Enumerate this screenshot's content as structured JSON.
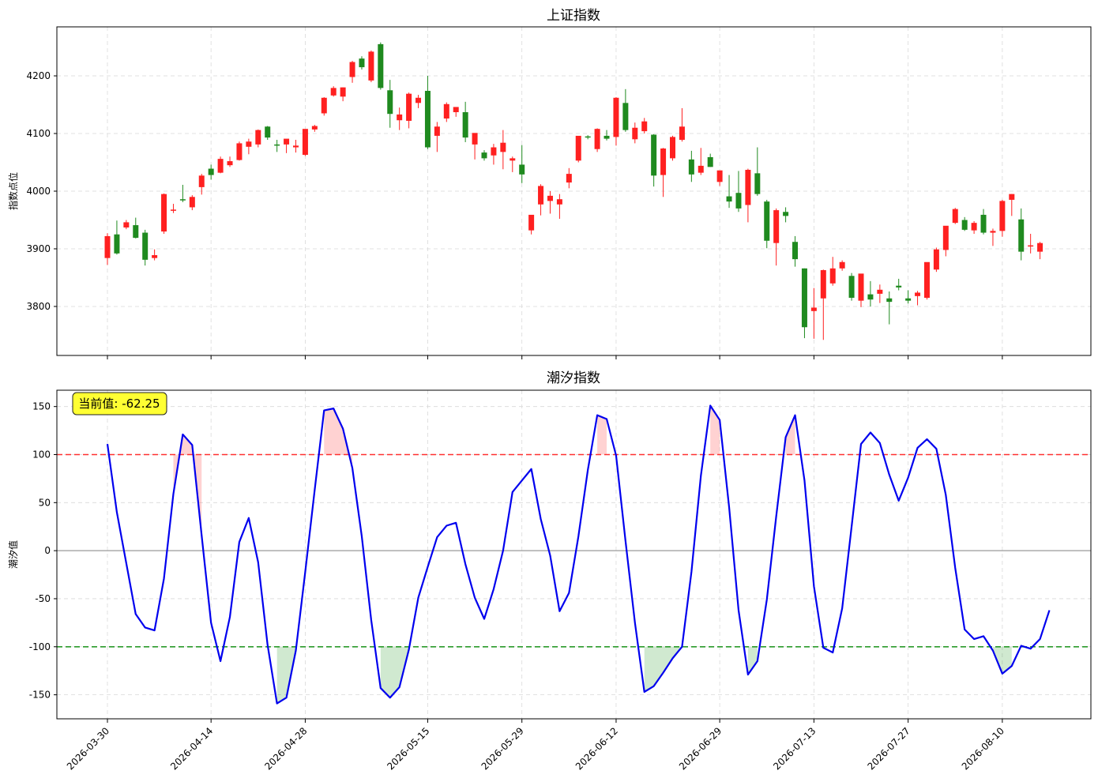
{
  "chart_data": [
    {
      "type": "candlestick",
      "title": "上证指数",
      "ylabel": "指数点位",
      "xlabel": "",
      "ylim": [
        3715,
        4285
      ],
      "yticks": [
        3800,
        3900,
        4000,
        4100,
        4200
      ],
      "grid": true,
      "colors": {
        "up": "#ff2020",
        "down": "#1f8a1f"
      },
      "x": [
        "2026-03-30",
        "2026-03-31",
        "2026-04-01",
        "2026-04-02",
        "2026-04-03",
        "2026-04-06",
        "2026-04-07",
        "2026-04-08",
        "2026-04-09",
        "2026-04-10",
        "2026-04-13",
        "2026-04-14",
        "2026-04-15",
        "2026-04-16",
        "2026-04-17",
        "2026-04-20",
        "2026-04-21",
        "2026-04-22",
        "2026-04-23",
        "2026-04-24",
        "2026-04-27",
        "2026-04-28",
        "2026-04-29",
        "2026-04-30",
        "2026-05-01",
        "2026-05-04",
        "2026-05-05",
        "2026-05-06",
        "2026-05-07",
        "2026-05-08",
        "2026-05-11",
        "2026-05-12",
        "2026-05-13",
        "2026-05-14",
        "2026-05-15",
        "2026-05-18",
        "2026-05-19",
        "2026-05-20",
        "2026-05-21",
        "2026-05-22",
        "2026-05-25",
        "2026-05-26",
        "2026-05-27",
        "2026-05-28",
        "2026-05-29",
        "2026-06-01",
        "2026-06-02",
        "2026-06-03",
        "2026-06-04",
        "2026-06-05",
        "2026-06-08",
        "2026-06-09",
        "2026-06-10",
        "2026-06-11",
        "2026-06-12",
        "2026-06-15",
        "2026-06-16",
        "2026-06-17",
        "2026-06-18",
        "2026-06-19",
        "2026-06-22",
        "2026-06-23",
        "2026-06-24",
        "2026-06-25",
        "2026-06-26",
        "2026-06-29",
        "2026-06-30",
        "2026-07-01",
        "2026-07-02",
        "2026-07-03",
        "2026-07-06",
        "2026-07-07",
        "2026-07-08",
        "2026-07-09",
        "2026-07-10",
        "2026-07-13",
        "2026-07-14",
        "2026-07-15",
        "2026-07-16",
        "2026-07-17",
        "2026-07-20",
        "2026-07-21",
        "2026-07-22",
        "2026-07-23",
        "2026-07-24",
        "2026-07-27",
        "2026-07-28",
        "2026-07-29",
        "2026-07-30",
        "2026-07-31",
        "2026-08-03",
        "2026-08-04",
        "2026-08-05",
        "2026-08-06",
        "2026-08-07",
        "2026-08-10",
        "2026-08-11",
        "2026-08-12",
        "2026-08-13",
        "2026-08-14",
        "2026-08-17",
        "2026-08-18",
        "2026-08-19",
        "2026-08-20",
        "2026-08-21",
        "2026-08-24"
      ],
      "xticks": [
        "2026-03-30",
        "2026-04-14",
        "2026-04-28",
        "2026-05-15",
        "2026-05-29",
        "2026-06-12",
        "2026-06-29",
        "2026-07-13",
        "2026-07-27",
        "2026-08-10"
      ],
      "ohlc": [
        [
          3884,
          3927,
          3872,
          3922
        ],
        [
          3925,
          3949,
          3890,
          3892
        ],
        [
          3937,
          3950,
          3934,
          3946
        ],
        [
          3941,
          3954,
          3918,
          3919
        ],
        [
          3928,
          3933,
          3871,
          3881
        ],
        [
          3884,
          3899,
          3880,
          3889
        ],
        [
          3930,
          3996,
          3926,
          3995
        ],
        [
          3966,
          3978,
          3962,
          3968
        ],
        [
          3986,
          4011,
          3981,
          3985
        ],
        [
          3972,
          3993,
          3967,
          3990
        ],
        [
          4007,
          4030,
          3994,
          4027
        ],
        [
          4039,
          4046,
          4020,
          4028
        ],
        [
          4032,
          4060,
          4031,
          4056
        ],
        [
          4045,
          4060,
          4042,
          4052
        ],
        [
          4054,
          4086,
          4053,
          4083
        ],
        [
          4077,
          4091,
          4064,
          4086
        ],
        [
          4081,
          4107,
          4076,
          4106
        ],
        [
          4112,
          4113,
          4089,
          4093
        ],
        [
          4081,
          4089,
          4068,
          4080
        ],
        [
          4081,
          4087,
          4066,
          4091
        ],
        [
          4076,
          4089,
          4067,
          4079
        ],
        [
          4063,
          4105,
          4061,
          4108
        ],
        [
          4107,
          4115,
          4103,
          4113
        ],
        [
          4135,
          4163,
          4131,
          4162
        ],
        [
          4166,
          4182,
          4164,
          4179
        ],
        [
          4164,
          4180,
          4156,
          4180
        ],
        [
          4198,
          4226,
          4188,
          4224
        ],
        [
          4230,
          4234,
          4211,
          4215
        ],
        [
          4192,
          4244,
          4189,
          4242
        ],
        [
          4255,
          4258,
          4176,
          4179
        ],
        [
          4175,
          4193,
          4110,
          4134
        ],
        [
          4123,
          4145,
          4106,
          4133
        ],
        [
          4122,
          4171,
          4109,
          4169
        ],
        [
          4153,
          4167,
          4144,
          4162
        ],
        [
          4174,
          4200,
          4073,
          4076
        ],
        [
          4096,
          4120,
          4068,
          4112
        ],
        [
          4126,
          4154,
          4120,
          4151
        ],
        [
          4137,
          4145,
          4129,
          4146
        ],
        [
          4137,
          4155,
          4085,
          4093
        ],
        [
          4081,
          4098,
          4055,
          4101
        ],
        [
          4067,
          4071,
          4053,
          4057
        ],
        [
          4062,
          4082,
          4046,
          4076
        ],
        [
          4068,
          4106,
          4038,
          4084
        ],
        [
          4053,
          4060,
          4033,
          4057
        ],
        [
          4046,
          4080,
          4014,
          4029
        ],
        [
          3932,
          3958,
          3925,
          3959
        ],
        [
          3977,
          4012,
          3958,
          4009
        ],
        [
          3983,
          4000,
          3961,
          3992
        ],
        [
          3977,
          3995,
          3952,
          3986
        ],
        [
          4015,
          4040,
          4005,
          4030
        ],
        [
          4053,
          4095,
          4050,
          4096
        ],
        [
          4095,
          4097,
          4090,
          4093
        ],
        [
          4073,
          4109,
          4068,
          4108
        ],
        [
          4096,
          4106,
          4088,
          4091
        ],
        [
          4094,
          4163,
          4079,
          4162
        ],
        [
          4153,
          4177,
          4103,
          4106
        ],
        [
          4090,
          4119,
          4083,
          4110
        ],
        [
          4104,
          4127,
          4100,
          4121
        ],
        [
          4098,
          4099,
          4008,
          4027
        ],
        [
          4028,
          4075,
          3990,
          4074
        ],
        [
          4057,
          4096,
          4053,
          4094
        ],
        [
          4089,
          4144,
          4086,
          4112
        ],
        [
          4055,
          4070,
          4016,
          4029
        ],
        [
          4032,
          4075,
          4028,
          4044
        ],
        [
          4059,
          4065,
          4042,
          4042
        ],
        [
          4016,
          4030,
          4009,
          4036
        ],
        [
          3991,
          4028,
          3971,
          3982
        ],
        [
          3997,
          4035,
          3964,
          3970
        ],
        [
          3976,
          4039,
          3946,
          4037
        ],
        [
          4031,
          4076,
          3992,
          3995
        ],
        [
          3982,
          3985,
          3901,
          3914
        ],
        [
          3910,
          3970,
          3871,
          3967
        ],
        [
          3964,
          3972,
          3946,
          3957
        ],
        [
          3912,
          3922,
          3869,
          3882
        ],
        [
          3866,
          3866,
          3745,
          3764
        ],
        [
          3792,
          3832,
          3744,
          3798
        ],
        [
          3814,
          3864,
          3742,
          3863
        ],
        [
          3840,
          3886,
          3836,
          3866
        ],
        [
          3866,
          3880,
          3862,
          3877
        ],
        [
          3853,
          3858,
          3810,
          3815
        ],
        [
          3810,
          3836,
          3799,
          3857
        ],
        [
          3821,
          3844,
          3800,
          3812
        ],
        [
          3822,
          3838,
          3806,
          3829
        ],
        [
          3814,
          3826,
          3769,
          3808
        ],
        [
          3836,
          3848,
          3828,
          3833
        ],
        [
          3814,
          3828,
          3805,
          3810
        ],
        [
          3818,
          3827,
          3802,
          3824
        ],
        [
          3815,
          3862,
          3812,
          3877
        ],
        [
          3864,
          3902,
          3860,
          3899
        ],
        [
          3898,
          3937,
          3887,
          3940
        ],
        [
          3945,
          3971,
          3943,
          3969
        ],
        [
          3950,
          3955,
          3931,
          3933
        ],
        [
          3932,
          3948,
          3926,
          3945
        ],
        [
          3959,
          3969,
          3925,
          3928
        ],
        [
          3928,
          3935,
          3905,
          3931
        ],
        [
          3931,
          3985,
          3921,
          3983
        ],
        [
          3985,
          3995,
          3957,
          3995
        ],
        [
          3951,
          3970,
          3880,
          3895
        ],
        [
          3906,
          3926,
          3892,
          3906
        ],
        [
          3895,
          3912,
          3882,
          3910
        ]
      ]
    },
    {
      "type": "line",
      "title": "潮汐指数",
      "ylabel": "潮汐值",
      "xlabel": "",
      "ylim": [
        -175,
        167
      ],
      "yticks": [
        -150,
        -100,
        -50,
        0,
        50,
        100,
        150
      ],
      "upper_threshold": 100,
      "lower_threshold": -100,
      "grid": true,
      "colors": {
        "line": "#0000ee",
        "upper": "#ff3030",
        "lower": "#2a9a2a"
      },
      "current_value_label": "当前值: -62.25",
      "x": [
        "2026-03-30",
        "2026-03-31",
        "2026-04-01",
        "2026-04-02",
        "2026-04-03",
        "2026-04-06",
        "2026-04-07",
        "2026-04-08",
        "2026-04-09",
        "2026-04-10",
        "2026-04-13",
        "2026-04-14",
        "2026-04-15",
        "2026-04-16",
        "2026-04-17",
        "2026-04-20",
        "2026-04-21",
        "2026-04-22",
        "2026-04-23",
        "2026-04-24",
        "2026-04-27",
        "2026-04-28",
        "2026-04-29",
        "2026-04-30",
        "2026-05-01",
        "2026-05-04",
        "2026-05-05",
        "2026-05-06",
        "2026-05-07",
        "2026-05-08",
        "2026-05-11",
        "2026-05-12",
        "2026-05-13",
        "2026-05-14",
        "2026-05-15",
        "2026-05-18",
        "2026-05-19",
        "2026-05-20",
        "2026-05-21",
        "2026-05-22",
        "2026-05-25",
        "2026-05-26",
        "2026-05-27",
        "2026-05-28",
        "2026-05-29",
        "2026-06-01",
        "2026-06-02",
        "2026-06-03",
        "2026-06-04",
        "2026-06-05",
        "2026-06-08",
        "2026-06-09",
        "2026-06-10",
        "2026-06-11",
        "2026-06-12",
        "2026-06-15",
        "2026-06-16",
        "2026-06-17",
        "2026-06-18",
        "2026-06-19",
        "2026-06-22",
        "2026-06-23",
        "2026-06-24",
        "2026-06-25",
        "2026-06-26",
        "2026-06-29",
        "2026-06-30",
        "2026-07-01",
        "2026-07-02",
        "2026-07-03",
        "2026-07-06",
        "2026-07-07",
        "2026-07-08",
        "2026-07-09",
        "2026-07-10",
        "2026-07-13",
        "2026-07-14",
        "2026-07-15",
        "2026-07-16",
        "2026-07-17",
        "2026-07-20",
        "2026-07-21",
        "2026-07-22",
        "2026-07-23",
        "2026-07-24",
        "2026-07-27",
        "2026-07-28",
        "2026-07-29",
        "2026-07-30",
        "2026-07-31",
        "2026-08-03",
        "2026-08-04",
        "2026-08-05",
        "2026-08-06",
        "2026-08-07",
        "2026-08-10",
        "2026-08-11",
        "2026-08-12",
        "2026-08-13",
        "2026-08-14",
        "2026-08-17",
        "2026-08-18",
        "2026-08-19",
        "2026-08-20",
        "2026-08-21",
        "2026-08-24"
      ],
      "xticks": [
        "2026-03-30",
        "2026-04-14",
        "2026-04-28",
        "2026-05-15",
        "2026-05-29",
        "2026-06-12",
        "2026-06-29",
        "2026-07-13",
        "2026-07-27",
        "2026-08-10"
      ],
      "values": [
        111,
        40,
        -13,
        -66,
        -80,
        -83,
        -29,
        59,
        121,
        110,
        16,
        -75,
        -115,
        -69,
        9,
        34,
        -12,
        -98,
        -159,
        -153,
        -104,
        -22,
        63,
        146,
        148,
        127,
        86,
        15,
        -72,
        -143,
        -153,
        -142,
        -103,
        -49,
        -17,
        14,
        26,
        29,
        -14,
        -49,
        -71,
        -40,
        0,
        61,
        73,
        85,
        33,
        -5,
        -63,
        -44,
        15,
        84,
        141,
        137,
        99,
        10,
        -75,
        -147,
        -141,
        -127,
        -112,
        -100,
        -22,
        78,
        151,
        136,
        45,
        -62,
        -129,
        -115,
        -51,
        36,
        118,
        141,
        73,
        -37,
        -101,
        -106,
        -60,
        25,
        111,
        123,
        112,
        79,
        52,
        76,
        107,
        116,
        106,
        58,
        -18,
        -82,
        -92,
        -89,
        -104,
        -128,
        -120,
        -99,
        -102,
        -92,
        -62
      ],
      "fills": [
        {
          "kind": "upper",
          "from": 7,
          "to": 10
        },
        {
          "kind": "upper",
          "from": 23,
          "to": 26
        },
        {
          "kind": "upper",
          "from": 52,
          "to": 53
        },
        {
          "kind": "upper",
          "from": 64,
          "to": 65
        },
        {
          "kind": "upper",
          "from": 72,
          "to": 73
        },
        {
          "kind": "lower",
          "from": 18,
          "to": 20
        },
        {
          "kind": "lower",
          "from": 29,
          "to": 32
        },
        {
          "kind": "lower",
          "from": 57,
          "to": 61
        },
        {
          "kind": "lower",
          "from": 68,
          "to": 69
        },
        {
          "kind": "lower",
          "from": 94,
          "to": 96
        }
      ]
    }
  ]
}
